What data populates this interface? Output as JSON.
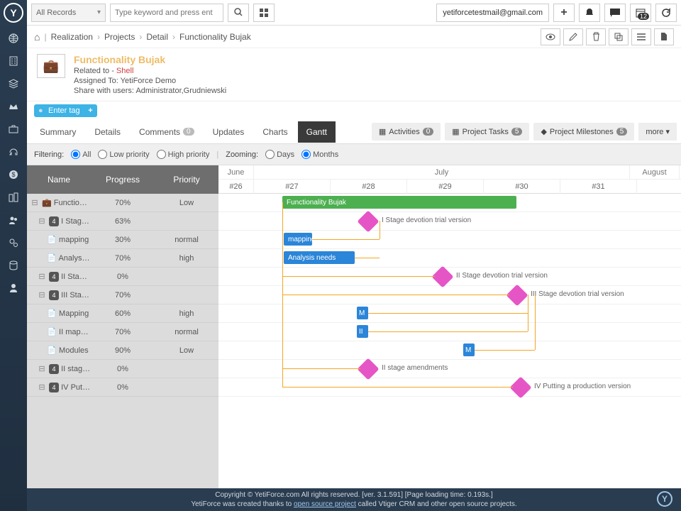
{
  "topbar": {
    "records_label": "All Records",
    "search_placeholder": "Type keyword and press ent",
    "user_email": "yetiforcetestmail@gmail.com",
    "calendar_count": "12"
  },
  "breadcrumb": {
    "home": "⌂",
    "seg1": "Realization",
    "seg2": "Projects",
    "seg3": "Detail",
    "seg4": "Functionality Bujak"
  },
  "record": {
    "title": "Functionality Bujak",
    "related_label": "Related to - ",
    "related_value": "Shell",
    "assigned_label": "Assigned To: ",
    "assigned_value": "YetiForce Demo",
    "share_label": "Share with users: ",
    "share_value": "Administrator,Grudniewski",
    "tag_placeholder": "Enter tag"
  },
  "tabs": {
    "summary": "Summary",
    "details": "Details",
    "comments": "Comments",
    "comments_count": "0",
    "updates": "Updates",
    "charts": "Charts",
    "gantt": "Gantt",
    "activities": "Activities",
    "activities_count": "0",
    "project_tasks": "Project Tasks",
    "project_tasks_count": "5",
    "project_milestones": "Project Milestones",
    "project_milestones_count": "5",
    "more": "more"
  },
  "filter": {
    "filtering_label": "Filtering:",
    "all": "All",
    "low": "Low priority",
    "high": "High priority",
    "zooming_label": "Zooming:",
    "days": "Days",
    "months": "Months"
  },
  "grid": {
    "headers": {
      "name": "Name",
      "progress": "Progress",
      "priority": "Priority"
    },
    "timeline": {
      "months": [
        "June",
        "July",
        "August"
      ],
      "month_widths": [
        50,
        530,
        70
      ],
      "weeks": [
        "#26",
        "#27",
        "#28",
        "#29",
        "#30",
        "#31"
      ]
    },
    "rows": [
      {
        "name": "Functionality Bujak",
        "progress": "70%",
        "priority": "Low",
        "indent": 0,
        "icon": "briefcase"
      },
      {
        "name": "I Stage devotion trial version",
        "progress": "63%",
        "priority": "",
        "indent": 1,
        "icon": "stage"
      },
      {
        "name": "mapping",
        "progress": "30%",
        "priority": "normal",
        "indent": 2,
        "icon": "doc"
      },
      {
        "name": "Analysis needs",
        "progress": "70%",
        "priority": "high",
        "indent": 2,
        "icon": "doc"
      },
      {
        "name": "II Stage devotion trial version",
        "progress": "0%",
        "priority": "",
        "indent": 1,
        "icon": "stage"
      },
      {
        "name": "III Stage devotion trial version",
        "progress": "70%",
        "priority": "",
        "indent": 1,
        "icon": "stage"
      },
      {
        "name": "Mapping",
        "progress": "60%",
        "priority": "high",
        "indent": 2,
        "icon": "doc"
      },
      {
        "name": "II mapping",
        "progress": "70%",
        "priority": "normal",
        "indent": 2,
        "icon": "doc"
      },
      {
        "name": "Modules",
        "progress": "90%",
        "priority": "Low",
        "indent": 2,
        "icon": "doc"
      },
      {
        "name": "II stage amendments",
        "progress": "0%",
        "priority": "",
        "indent": 1,
        "icon": "stage"
      },
      {
        "name": "IV Putting a production version",
        "progress": "0%",
        "priority": "",
        "indent": 1,
        "icon": "stage"
      }
    ],
    "bars": {
      "main": "Functionality Bujak",
      "mapping": "mapping",
      "analysis": "Analysis needs",
      "m1": "M",
      "m2": "II",
      "m3": "M"
    },
    "milestones": {
      "ms1": "I Stage devotion trial version",
      "ms2": "II Stage devotion trial version",
      "ms3": "III Stage devotion trial version",
      "ms4": "II stage amendments",
      "ms5": "IV Putting a production version"
    }
  },
  "footer": {
    "line1": "Copyright © YetiForce.com All rights reserved. [ver. 3.1.591] [Page loading time: 0.193s.]",
    "line2a": "YetiForce was created thanks to ",
    "line2b": "open source project",
    "line2c": " called Vtiger CRM and other open source projects."
  }
}
